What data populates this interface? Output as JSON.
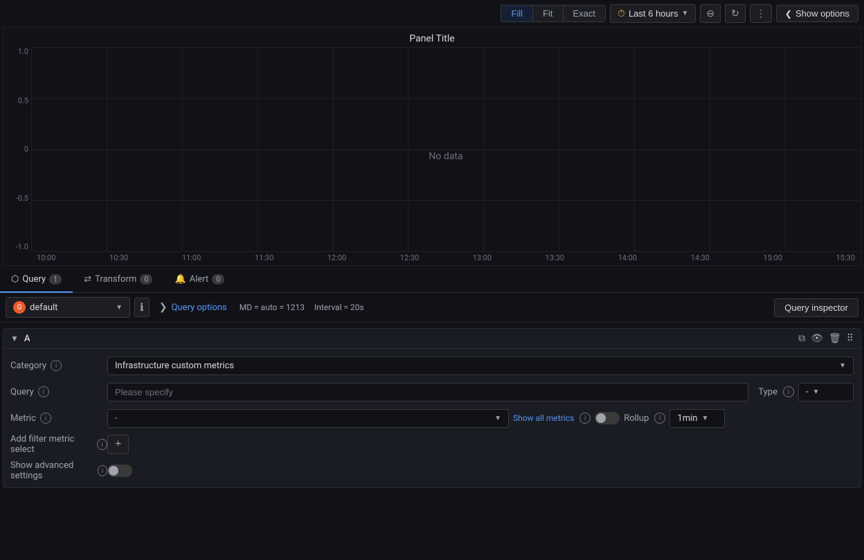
{
  "toolbar": {
    "fill_label": "Fill",
    "fit_label": "Fit",
    "exact_label": "Exact",
    "time_range": "Last 6 hours",
    "show_options_label": "Show options",
    "active_view": "Fill"
  },
  "chart": {
    "title": "Panel Title",
    "no_data": "No data",
    "y_labels": [
      "1.0",
      "0.5",
      "0",
      "-0.5",
      "-1.0"
    ],
    "x_labels": [
      "10:00",
      "10:30",
      "11:00",
      "11:30",
      "12:00",
      "12:30",
      "13:00",
      "13:30",
      "14:00",
      "14:30",
      "15:00",
      "15:30"
    ]
  },
  "tabs": [
    {
      "id": "query",
      "label": "Query",
      "count": "1",
      "active": true
    },
    {
      "id": "transform",
      "label": "Transform",
      "count": "0",
      "active": false
    },
    {
      "id": "alert",
      "label": "Alert",
      "count": "0",
      "active": false
    }
  ],
  "query_row": {
    "datasource": "default",
    "query_options_label": "Query options",
    "md_meta": "MD = auto = 1213",
    "interval_meta": "Interval = 20s",
    "inspector_label": "Query inspector"
  },
  "query_block": {
    "id": "A",
    "category_label": "Category",
    "category_value": "Infrastructure custom metrics",
    "query_label": "Query",
    "query_placeholder": "Please specify",
    "type_label": "Type",
    "type_value": "-",
    "metric_label": "Metric",
    "metric_value": "-",
    "show_all_metrics": "Show all metrics",
    "rollup_label": "Rollup",
    "rollup_value": "1min",
    "add_filter_label": "Add filter metric select",
    "add_filter_btn": "+",
    "advanced_settings_label": "Show advanced settings"
  }
}
